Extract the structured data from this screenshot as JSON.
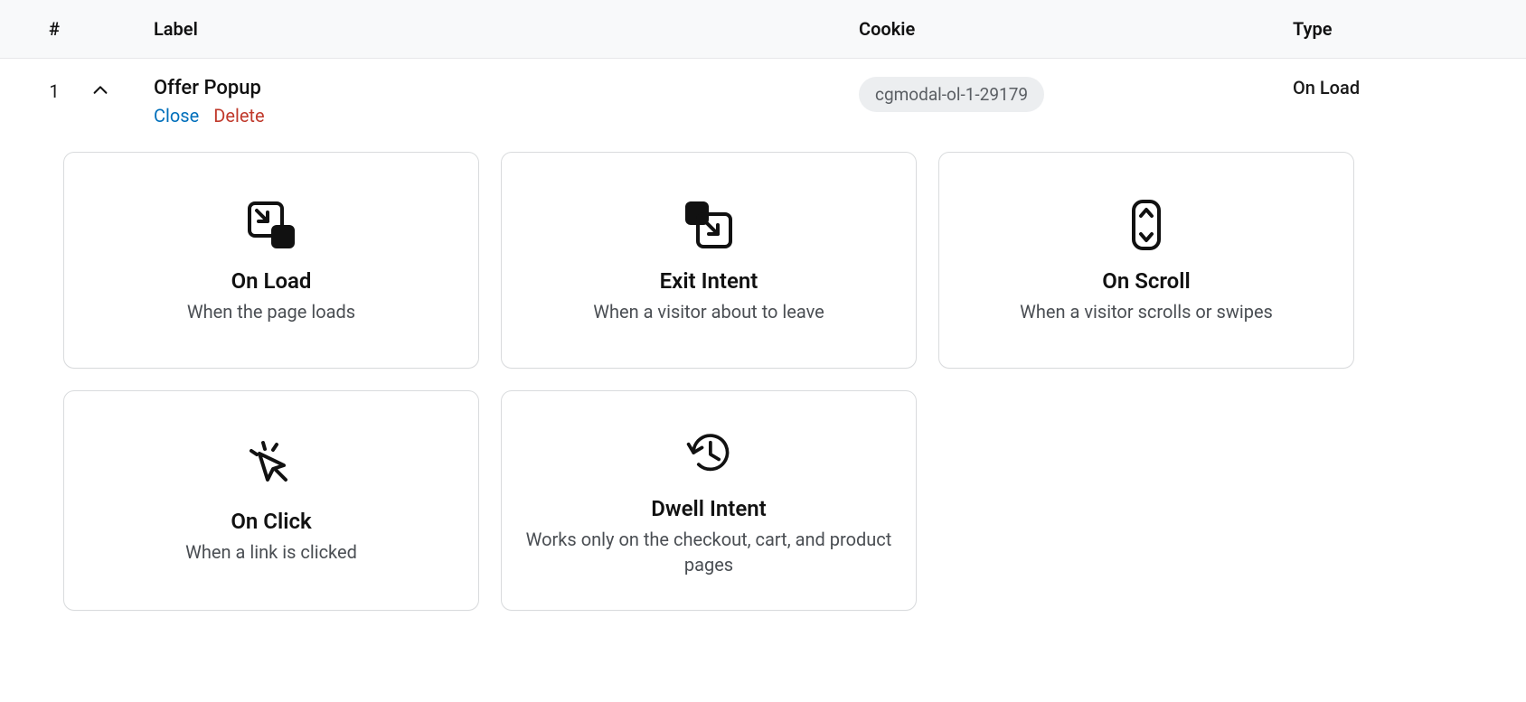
{
  "table": {
    "headers": {
      "hash": "#",
      "label": "Label",
      "cookie": "Cookie",
      "type": "Type"
    },
    "row": {
      "num": "1",
      "label": "Offer Popup",
      "actions": {
        "close": "Close",
        "delete": "Delete"
      },
      "cookie": "cgmodal-ol-1-29179",
      "type": "On Load"
    }
  },
  "cards": {
    "onload": {
      "title": "On Load",
      "desc": "When the page loads"
    },
    "exit": {
      "title": "Exit Intent",
      "desc": "When a visitor about to leave"
    },
    "scroll": {
      "title": "On Scroll",
      "desc": "When a visitor scrolls or swipes"
    },
    "click": {
      "title": "On Click",
      "desc": "When a link is clicked"
    },
    "dwell": {
      "title": "Dwell Intent",
      "desc": "Works only on the checkout, cart, and product pages"
    }
  }
}
